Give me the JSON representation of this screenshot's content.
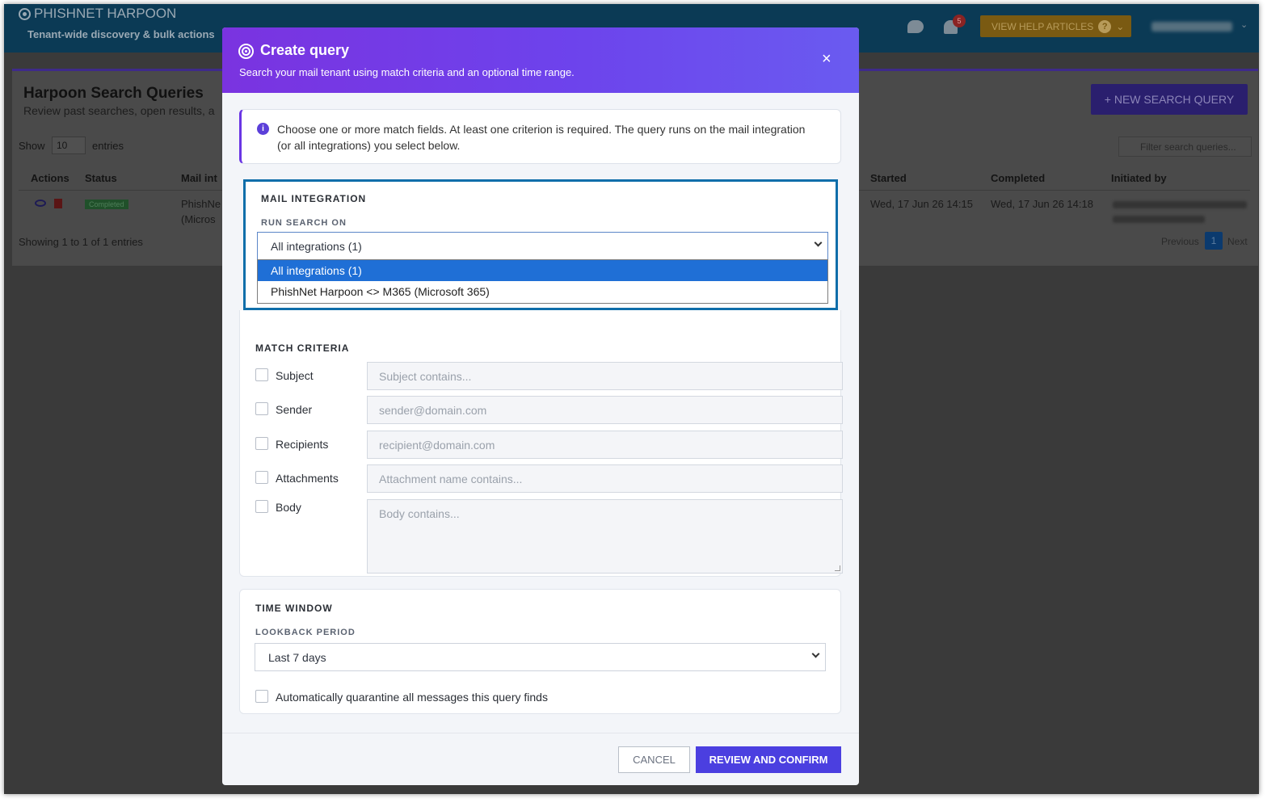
{
  "app": {
    "brand": "PHISHNET HARPOON",
    "tagline": "Tenant-wide discovery & bulk actions",
    "notification_count": "5",
    "help_label": "VIEW HELP ARTICLES",
    "help_q": "?"
  },
  "page": {
    "title": "Harpoon Search Queries",
    "subtitle": "Review past searches, open results, a",
    "new_query_label": "+ NEW SEARCH QUERY",
    "show_label": "Show",
    "show_value": "10",
    "entries_label": "entries",
    "filter_placeholder": "Filter search queries...",
    "columns": [
      "Actions",
      "Status",
      "Mail int",
      "Started",
      "Completed",
      "Initiated by"
    ],
    "row": {
      "status": "Completed",
      "mail_line1": "PhishNe",
      "mail_line2": "(Micros",
      "started": "Wed, 17 Jun 26 14:15",
      "completed": "Wed, 17 Jun 26 14:18"
    },
    "showing": "Showing 1 to 1 of 1 entries",
    "prev": "Previous",
    "page_num": "1",
    "next": "Next"
  },
  "modal": {
    "title": "Create query",
    "subtitle": "Search your mail tenant using match criteria and an optional time range.",
    "close": "×",
    "info_icon": "i",
    "info": "Choose one or more match fields. At least one criterion is required. The query runs on the mail integration (or all integrations) you select below.",
    "mail_integration": {
      "heading": "MAIL INTEGRATION",
      "label": "RUN SEARCH ON",
      "selected": "All integrations (1)",
      "options": [
        "All integrations (1)",
        "PhishNet Harpoon <> M365 (Microsoft 365)"
      ]
    },
    "match_criteria": {
      "heading": "MATCH CRITERIA",
      "fields": [
        {
          "label": "Subject",
          "placeholder": "Subject contains..."
        },
        {
          "label": "Sender",
          "placeholder": "sender@domain.com"
        },
        {
          "label": "Recipients",
          "placeholder": "recipient@domain.com"
        },
        {
          "label": "Attachments",
          "placeholder": "Attachment name contains..."
        },
        {
          "label": "Body",
          "placeholder": "Body contains..."
        }
      ]
    },
    "time_window": {
      "heading": "TIME WINDOW",
      "label": "LOOKBACK PERIOD",
      "selected": "Last 7 days"
    },
    "quarantine_label": "Automatically quarantine all messages this query finds",
    "cancel": "CANCEL",
    "confirm": "REVIEW AND CONFIRM"
  },
  "colors": {
    "header_gradient_start": "#7a33e0",
    "header_gradient_end": "#6a5bf0",
    "primary_button": "#4b3fe0",
    "focus_outline": "#0f6eaa",
    "selected_option": "#1f6fd6"
  }
}
